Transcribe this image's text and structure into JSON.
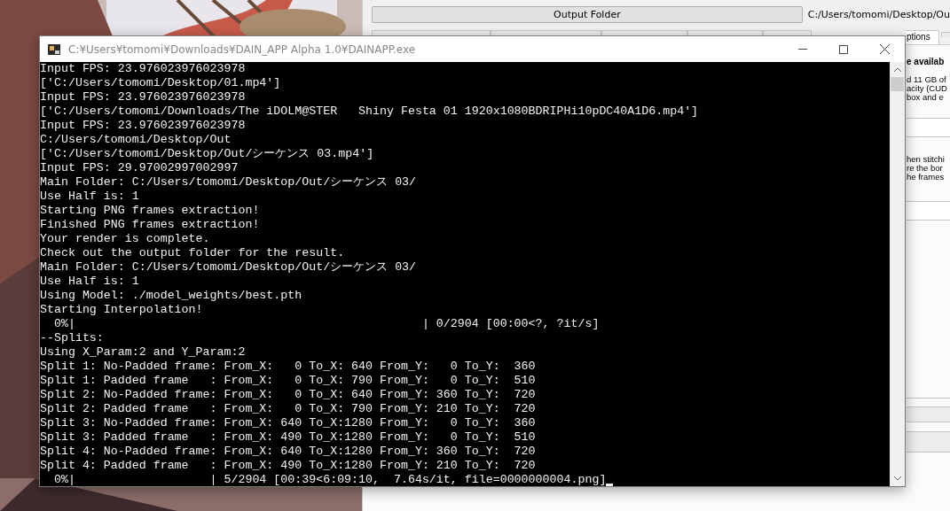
{
  "background_app": {
    "output_button": "Output Folder",
    "output_path": "C:/Users/tomomi/Desktop/Ou",
    "tabs": [
      {
        "label": "ptions",
        "selected": true
      }
    ],
    "panel_texts": [
      {
        "text": "e availab",
        "kind": "heading"
      },
      {
        "text": "d 11 GB of",
        "kind": "body"
      },
      {
        "text": "acity (CUD",
        "kind": "body"
      },
      {
        "text": "box and e",
        "kind": "body"
      },
      {
        "text": "hen stitchi",
        "kind": "body"
      },
      {
        "text": "re the bor",
        "kind": "body"
      },
      {
        "text": "he frames",
        "kind": "body"
      }
    ]
  },
  "console": {
    "title": "C:¥Users¥tomomi¥Downloads¥DAIN_APP Alpha 1.0¥DAINAPP.exe",
    "lines": [
      "Input FPS: 23.976023976023978",
      "['C:/Users/tomomi/Desktop/01.mp4']",
      "Input FPS: 23.976023976023978",
      "['C:/Users/tomomi/Downloads/The iDOLM@STER   Shiny Festa 01 1920x1080BDRIPHi10pDC40A1D6.mp4']",
      "Input FPS: 23.976023976023978",
      "C:/Users/tomomi/Desktop/Out",
      "['C:/Users/tomomi/Desktop/Out/シーケンス 03.mp4']",
      "Input FPS: 29.97002997002997",
      "Main Folder: C:/Users/tomomi/Desktop/Out/シーケンス 03/",
      "Use Half is: 1",
      "Starting PNG frames extraction!",
      "Finished PNG frames extraction!",
      "Your render is complete.",
      "Check out the output folder for the result.",
      "Main Folder: C:/Users/tomomi/Desktop/Out/シーケンス 03/",
      "Use Half is: 1",
      "Using Model: ./model_weights/best.pth",
      "Starting Interpolation!",
      "  0%|                                                 | 0/2904 [00:00<?, ?it/s]",
      "--Splits:",
      "Using X_Param:2 and Y_Param:2",
      "Split 1: No-Padded frame: From_X:   0 To_X: 640 From_Y:   0 To_Y:  360",
      "Split 1: Padded frame   : From_X:   0 To_X: 790 From_Y:   0 To_Y:  510",
      "Split 2: No-Padded frame: From_X:   0 To_X: 640 From_Y: 360 To_Y:  720",
      "Split 2: Padded frame   : From_X:   0 To_X: 790 From_Y: 210 To_Y:  720",
      "Split 3: No-Padded frame: From_X: 640 To_X:1280 From_Y:   0 To_Y:  360",
      "Split 3: Padded frame   : From_X: 490 To_X:1280 From_Y:   0 To_Y:  510",
      "Split 4: No-Padded frame: From_X: 640 To_X:1280 From_Y: 360 To_Y:  720",
      "Split 4: Padded frame   : From_X: 490 To_X:1280 From_Y: 210 To_Y:  720",
      "  0%|                   | 5/2904 [00:39<6:09:10,  7.64s/it, file=0000000004.png]"
    ]
  }
}
